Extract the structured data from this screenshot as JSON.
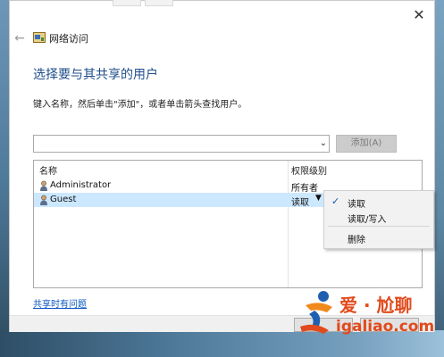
{
  "window": {
    "title": "网络访问",
    "close_glyph": "✕",
    "back_glyph": "←"
  },
  "page": {
    "heading": "选择要与其共享的用户",
    "instruction": "键入名称，然后单击\"添加\"，或者单击箭头查找用户。"
  },
  "combo": {
    "value": "",
    "arrow_glyph": "⌄"
  },
  "add_button": {
    "label": "添加(A)"
  },
  "table": {
    "headers": {
      "name": "名称",
      "permission": "权限级别"
    },
    "rows": [
      {
        "name": "Administrator",
        "permission": "所有者"
      },
      {
        "name": "Guest",
        "permission": "读取",
        "selected": true
      }
    ]
  },
  "permission_menu": {
    "items": [
      {
        "label": "读取",
        "checked": true
      },
      {
        "label": "读取/写入",
        "checked": false
      },
      {
        "label": "删除",
        "checked": false
      }
    ],
    "check_glyph": "✓"
  },
  "help_link": {
    "label": "共享时有问题"
  },
  "watermark": {
    "chinese": "爱 · 尬聊",
    "domain": "igaliao.com"
  },
  "colors": {
    "heading": "#1f4e8c",
    "selection": "#cce8ff",
    "link": "#0b57c6",
    "watermark": "#e14a1c"
  }
}
